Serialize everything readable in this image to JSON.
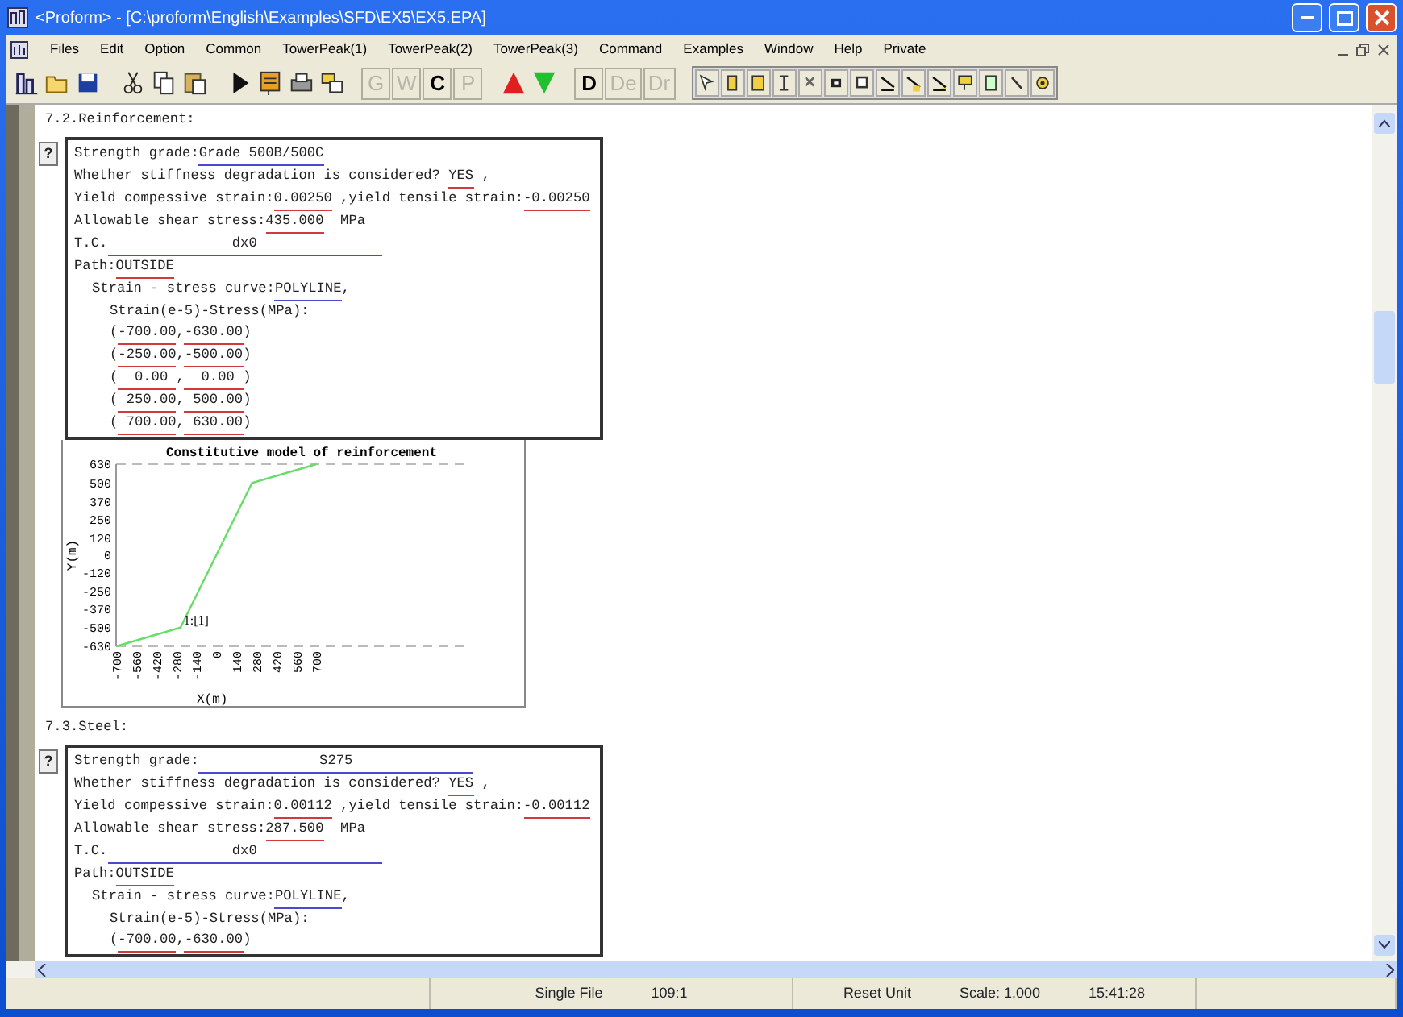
{
  "window": {
    "title": "<Proform> - [C:\\proform\\English\\Examples\\SFD\\EX5\\EX5.EPA]"
  },
  "menu": [
    "Files",
    "Edit",
    "Option",
    "Common",
    "TowerPeak(1)",
    "TowerPeak(2)",
    "TowerPeak(3)",
    "Command",
    "Examples",
    "Window",
    "Help",
    "Private"
  ],
  "toolbar": [
    {
      "kind": "file"
    },
    {
      "kind": "edit"
    },
    {
      "kind": "run"
    },
    {
      "kind": "letters",
      "buttons": [
        {
          "label": "G",
          "disabled": true
        },
        {
          "label": "W",
          "disabled": true
        },
        {
          "label": "C",
          "disabled": false
        },
        {
          "label": "P",
          "disabled": true
        }
      ]
    },
    {
      "kind": "arrows"
    },
    {
      "kind": "letters",
      "buttons": [
        {
          "label": "D",
          "disabled": false
        },
        {
          "label": "De",
          "disabled": true
        },
        {
          "label": "Dr",
          "disabled": true
        }
      ]
    },
    {
      "kind": "tools"
    }
  ],
  "sections": [
    {
      "heading": "7.2.Reinforcement:",
      "block": {
        "help_marker": "?",
        "lines": [
          {
            "segments": [
              {
                "text": "Strength grade:"
              },
              {
                "field": "Grade 500B/500C",
                "kind": "choice"
              }
            ]
          },
          {
            "segments": [
              {
                "text": "Whether stiffness degradation is considered? "
              },
              {
                "field": "YES",
                "kind": "input"
              },
              {
                "text": " ,"
              }
            ]
          },
          {
            "segments": [
              {
                "text": "Yield compessive strain:"
              },
              {
                "field": "0.00250",
                "kind": "input"
              },
              {
                "text": " ,yield tensile strain:"
              },
              {
                "field": "-0.00250",
                "kind": "input"
              }
            ]
          },
          {
            "segments": [
              {
                "text": "Allowable shear stress:"
              },
              {
                "field": "435.000",
                "kind": "input"
              },
              {
                "text": "  MPa"
              }
            ]
          },
          {
            "segments": [
              {
                "text": "T.C."
              },
              {
                "field": "dx0",
                "kind": "choice",
                "wide": true
              }
            ]
          },
          {
            "segments": [
              {
                "text": "Path:"
              },
              {
                "field": "OUTSIDE",
                "kind": "input"
              }
            ],
            "children": [
              {
                "segments": [
                  {
                    "text": "Strain - stress curve:"
                  },
                  {
                    "field": "POLYLINE",
                    "kind": "choice"
                  },
                  {
                    "text": ","
                  }
                ],
                "children": [
                  {
                    "segments": [
                      {
                        "text": "Strain(e-5)-Stress(MPa):"
                      }
                    ]
                  },
                  {
                    "segments": [
                      {
                        "text": "("
                      },
                      {
                        "field": "-700.00",
                        "kind": "input"
                      },
                      {
                        "text": ","
                      },
                      {
                        "field": "-630.00",
                        "kind": "input"
                      },
                      {
                        "text": ")"
                      }
                    ]
                  },
                  {
                    "segments": [
                      {
                        "text": "("
                      },
                      {
                        "field": "-250.00",
                        "kind": "input"
                      },
                      {
                        "text": ","
                      },
                      {
                        "field": "-500.00",
                        "kind": "input"
                      },
                      {
                        "text": ")"
                      }
                    ]
                  },
                  {
                    "segments": [
                      {
                        "text": "("
                      },
                      {
                        "field": "  0.00 ",
                        "kind": "input"
                      },
                      {
                        "text": ","
                      },
                      {
                        "field": "  0.00 ",
                        "kind": "input"
                      },
                      {
                        "text": ")"
                      }
                    ]
                  },
                  {
                    "segments": [
                      {
                        "text": "("
                      },
                      {
                        "field": " 250.00",
                        "kind": "input"
                      },
                      {
                        "text": ","
                      },
                      {
                        "field": " 500.00",
                        "kind": "input"
                      },
                      {
                        "text": ")"
                      }
                    ]
                  },
                  {
                    "segments": [
                      {
                        "text": "("
                      },
                      {
                        "field": " 700.00",
                        "kind": "input"
                      },
                      {
                        "text": ","
                      },
                      {
                        "field": " 630.00",
                        "kind": "input"
                      },
                      {
                        "text": ")"
                      }
                    ]
                  }
                ]
              }
            ]
          }
        ]
      },
      "chart_data": {
        "type": "line",
        "title": "Constitutive model of reinforcement",
        "xlabel": "X(m)",
        "ylabel": "Y(m)",
        "x": [
          -700,
          -250,
          0,
          250,
          700
        ],
        "series": [
          {
            "name": "1:[1]",
            "color": "#66dd66",
            "values": [
              -630,
              -500,
              0,
              500,
              630
            ]
          }
        ],
        "xlim": [
          -700,
          1780
        ],
        "ylim": [
          -630,
          630
        ],
        "xticks": [
          -700,
          -560,
          -420,
          -280,
          -140,
          0,
          140,
          280,
          420,
          560,
          700
        ],
        "yticks": [
          630,
          500,
          370,
          250,
          120,
          0,
          -120,
          -250,
          -370,
          -500,
          -630
        ]
      }
    },
    {
      "heading": "7.3.Steel:",
      "block": {
        "help_marker": "?",
        "lines": [
          {
            "segments": [
              {
                "text": "Strength grade:"
              },
              {
                "field": "S275",
                "kind": "choice",
                "wide": true
              }
            ]
          },
          {
            "segments": [
              {
                "text": "Whether stiffness degradation is considered? "
              },
              {
                "field": "YES",
                "kind": "input"
              },
              {
                "text": " ,"
              }
            ]
          },
          {
            "segments": [
              {
                "text": "Yield compessive strain:"
              },
              {
                "field": "0.00112",
                "kind": "input"
              },
              {
                "text": " ,yield tensile strain:"
              },
              {
                "field": "-0.00112",
                "kind": "input"
              }
            ]
          },
          {
            "segments": [
              {
                "text": "Allowable shear stress:"
              },
              {
                "field": "287.500",
                "kind": "input"
              },
              {
                "text": "  MPa"
              }
            ]
          },
          {
            "segments": [
              {
                "text": "T.C."
              },
              {
                "field": "dx0",
                "kind": "choice",
                "wide": true
              }
            ]
          },
          {
            "segments": [
              {
                "text": "Path:"
              },
              {
                "field": "OUTSIDE",
                "kind": "input"
              }
            ],
            "children": [
              {
                "segments": [
                  {
                    "text": "Strain - stress curve:"
                  },
                  {
                    "field": "POLYLINE",
                    "kind": "choice"
                  },
                  {
                    "text": ","
                  }
                ],
                "children": [
                  {
                    "segments": [
                      {
                        "text": "Strain(e-5)-Stress(MPa):"
                      }
                    ]
                  },
                  {
                    "segments": [
                      {
                        "text": "("
                      },
                      {
                        "field": "-700.00",
                        "kind": "input"
                      },
                      {
                        "text": ","
                      },
                      {
                        "field": "-630.00",
                        "kind": "input"
                      },
                      {
                        "text": ")"
                      }
                    ]
                  }
                ]
              }
            ]
          }
        ]
      }
    }
  ],
  "status_bar": [
    {
      "texts": [
        "Single File",
        "109:1"
      ]
    },
    {
      "texts": [
        "Reset Unit",
        "Scale: 1.000",
        "15:41:28"
      ]
    }
  ]
}
